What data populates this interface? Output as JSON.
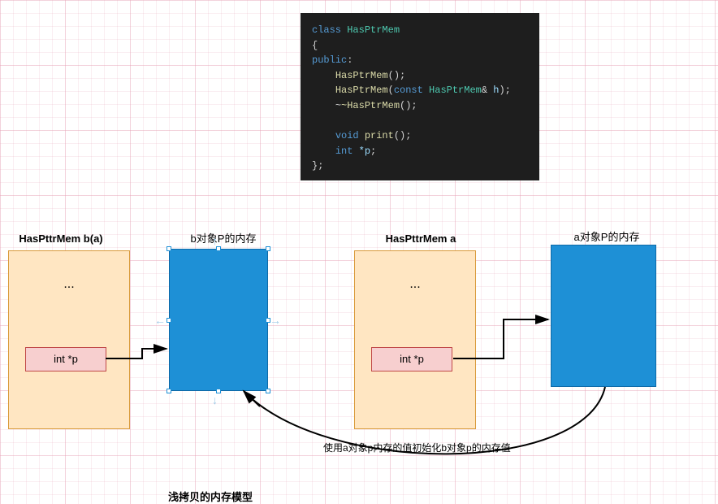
{
  "code": {
    "class_kw": "class",
    "class_name": "HasPtrMem",
    "lbrace": "{",
    "public_kw": "public",
    "ctor_default": "HasPtrMem",
    "ctor_copy": "HasPtrMem",
    "const_kw": "const",
    "param_type": "HasPtrMem",
    "amp": "&",
    "param_name": "h",
    "dtor": "~HasPtrMem",
    "void_kw": "void",
    "print_fn": "print",
    "int_kw": "int",
    "ptr_decl": "*p",
    "rbrace_semi": "};"
  },
  "left": {
    "obj_title": "HasPttrMem b(a)",
    "mem_title": "b对象P的内存",
    "ellipsis": "...",
    "ptr_label": "int *p"
  },
  "right": {
    "obj_title": "HasPttrMem a",
    "mem_title": "a对象P的内存",
    "ellipsis": "...",
    "ptr_label": "int *p"
  },
  "arrow_note": "使用a对象p内存的值初始化b对象p的内存值",
  "caption": "浅拷贝的内存模型"
}
